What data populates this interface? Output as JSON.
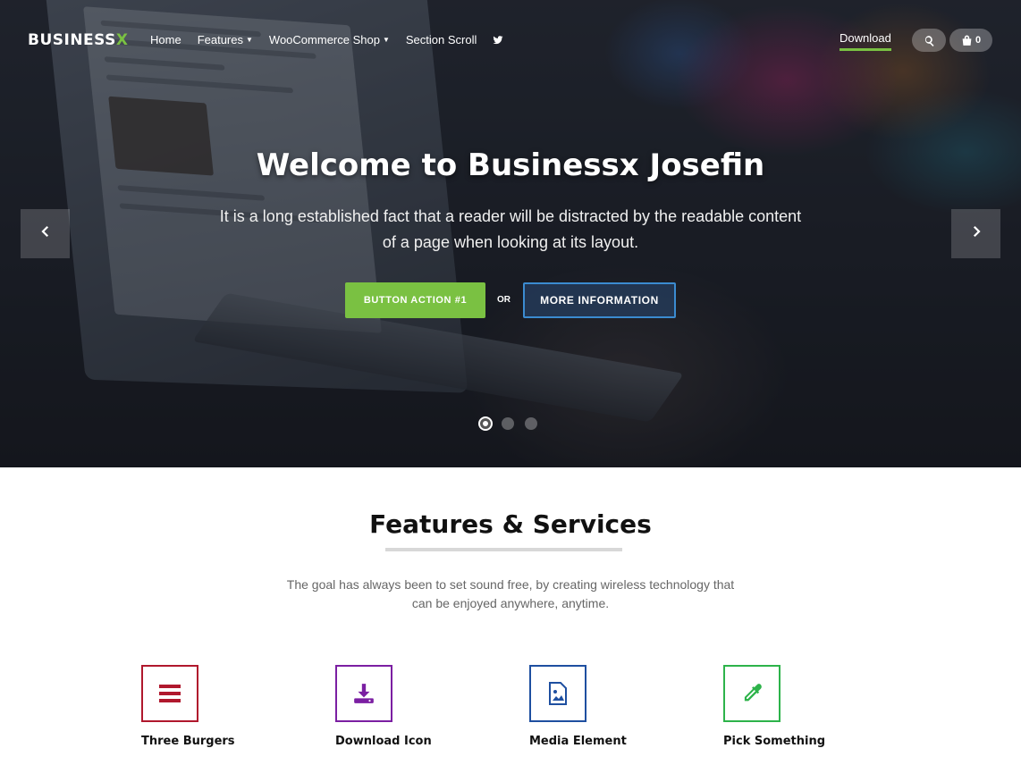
{
  "brand": {
    "name_main": "BUSINESS",
    "name_accent": "X",
    "accent_color": "#7ac142"
  },
  "nav": {
    "items": [
      {
        "label": "Home",
        "has_caret": false
      },
      {
        "label": "Features",
        "has_caret": true
      },
      {
        "label": "WooCommerce Shop",
        "has_caret": true
      },
      {
        "label": "Section Scroll",
        "has_caret": false
      }
    ],
    "twitter_icon": "twitter-icon",
    "download_label": "Download",
    "search_icon": "search-icon",
    "cart_icon": "cart-icon",
    "cart_count": "0"
  },
  "hero": {
    "title": "Welcome to Businessx Josefin",
    "subtitle": "It is a long established fact that a reader will be distracted by the readable content of a page when looking at its layout.",
    "primary_button": "BUTTON ACTION #1",
    "or_label": "OR",
    "secondary_button": "MORE INFORMATION",
    "prev_icon": "chevron-left-icon",
    "next_icon": "chevron-right-icon",
    "slide_count": 3,
    "active_slide": 1
  },
  "features": {
    "title": "Features & Services",
    "description": "The goal has always been to set sound free, by creating wireless technology that can be enjoyed anywhere, anytime.",
    "items": [
      {
        "label": "Three Burgers",
        "icon": "menu-icon",
        "color": "#b0182d"
      },
      {
        "label": "Download Icon",
        "icon": "download-icon",
        "color": "#7b1fa2"
      },
      {
        "label": "Media Element",
        "icon": "image-icon",
        "color": "#1e4fa0"
      },
      {
        "label": "Pick Something",
        "icon": "eyedropper-icon",
        "color": "#2db34a"
      }
    ]
  },
  "colors": {
    "green": "#7ac142",
    "blue": "#3b8bd0"
  }
}
